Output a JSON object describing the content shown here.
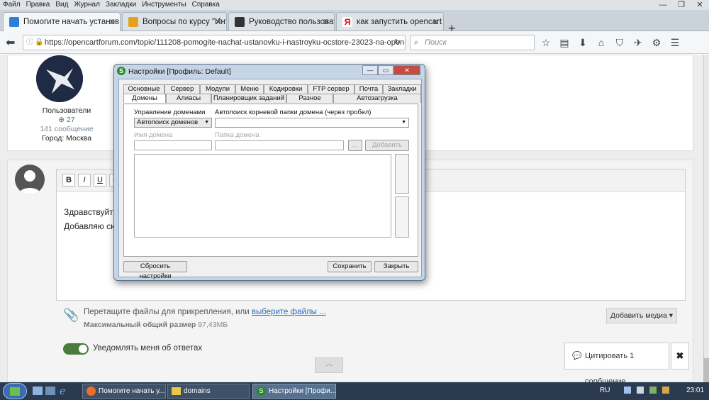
{
  "browser": {
    "menu": [
      "Файл",
      "Правка",
      "Вид",
      "Журнал",
      "Закладки",
      "Инструменты",
      "Справка"
    ],
    "tabs": [
      {
        "label": "Помогите начать установ...",
        "active": true
      },
      {
        "label": "Вопросы по курсу \"Интер...",
        "active": false
      },
      {
        "label": "Руководство пользовател...",
        "active": false
      },
      {
        "label": "как запустить opencart на ...",
        "active": false
      }
    ],
    "new_tab": "+",
    "url": "https://opencartforum.com/topic/111208-pomogite-nachat-ustanovku-i-nastroyku-ocstore-23023-na-open-server/",
    "search_placeholder": "Поиск"
  },
  "profile": {
    "group": "Пользователи",
    "reputation": "27",
    "posts": "141 сообщение",
    "city": "Город: Москва"
  },
  "editor": {
    "buttons": [
      "B",
      "I",
      "U",
      "S"
    ],
    "line1": "Здравствуйте,",
    "line2": "Добавляю скри"
  },
  "attach": {
    "text": "Перетащите файлы для прикрепления, или",
    "link": "выберите файлы ...",
    "max_label": "Максимальный общий размер",
    "max_value": "97,43МБ",
    "add_media": "Добавить медиа ▾"
  },
  "notify_label": "Уведомлять меня об ответах",
  "quote_button": "Цитировать 1 сообщение",
  "quote_close": "✖",
  "dialog": {
    "title": "Настройки [Профиль: Default]",
    "logo": "S",
    "tabs_row1": [
      "Основные",
      "Сервер",
      "Модули",
      "Меню",
      "Кодировки",
      "FTP сервер",
      "Почта",
      "Закладки"
    ],
    "tabs_row2": [
      "Домены",
      "Алиасы",
      "Планировщик заданий",
      "Разное",
      "Автозагрузка"
    ],
    "domain_mgmt_label": "Управление доменами",
    "domain_mgmt_value": "Автопоиск доменов",
    "autosearch_label": "Автопоиск корневой папки домена (через пробел)",
    "domain_name_label": "Имя домена",
    "domain_folder_label": "Папка домена",
    "browse": "...",
    "add": "Добавить",
    "reset": "Сбросить настройки",
    "save": "Сохранить",
    "close": "Закрыть"
  },
  "taskbar": {
    "items": [
      {
        "label": "Помогите начать у..."
      },
      {
        "label": "domains"
      },
      {
        "label": "Настройки [Профи..."
      }
    ],
    "lang": "RU",
    "time": "23:01"
  }
}
